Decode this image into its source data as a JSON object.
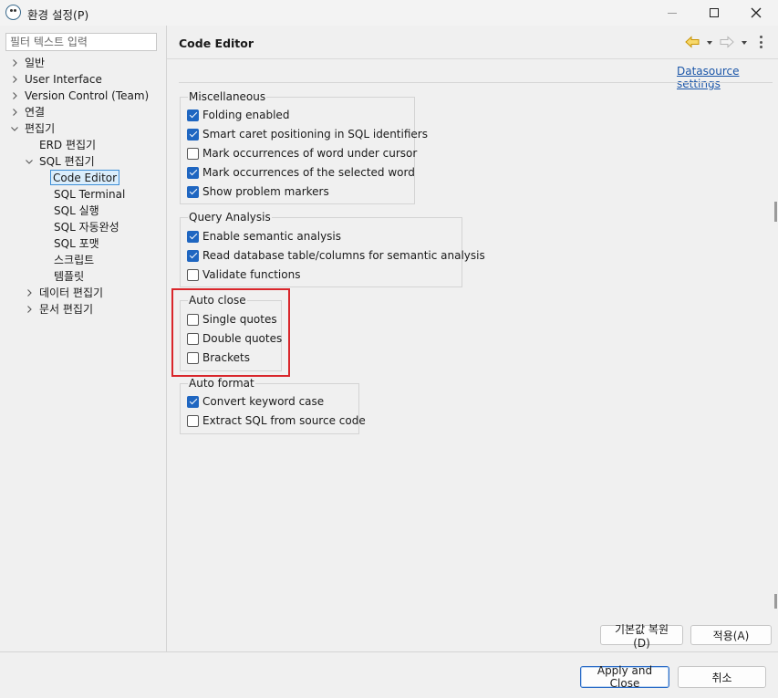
{
  "window": {
    "title": "환경 설정(P)"
  },
  "filter": {
    "placeholder": "필터 텍스트 입력"
  },
  "tree": {
    "items": [
      {
        "label": "일반"
      },
      {
        "label": "User Interface"
      },
      {
        "label": "Version Control (Team)"
      },
      {
        "label": "연결"
      },
      {
        "label": "편집기"
      },
      {
        "label": "ERD 편집기"
      },
      {
        "label": "SQL 편집기"
      },
      {
        "label": "Code Editor"
      },
      {
        "label": "SQL Terminal"
      },
      {
        "label": "SQL 실행"
      },
      {
        "label": "SQL 자동완성"
      },
      {
        "label": "SQL 포맷"
      },
      {
        "label": "스크립트"
      },
      {
        "label": "템플릿"
      },
      {
        "label": "데이터 편집기"
      },
      {
        "label": "문서 편집기"
      }
    ],
    "selected": "Code Editor"
  },
  "page": {
    "title": "Code Editor",
    "datasource_link": "Datasource settings"
  },
  "groups": {
    "miscellaneous": {
      "title": "Miscellaneous",
      "options": [
        {
          "label": "Folding enabled",
          "checked": true
        },
        {
          "label": "Smart caret positioning in SQL identifiers",
          "checked": true
        },
        {
          "label": "Mark occurrences of word under cursor",
          "checked": false
        },
        {
          "label": "Mark occurrences of the selected word",
          "checked": true
        },
        {
          "label": "Show problem markers",
          "checked": true
        }
      ]
    },
    "query_analysis": {
      "title": "Query Analysis",
      "options": [
        {
          "label": "Enable semantic analysis",
          "checked": true
        },
        {
          "label": "Read database table/columns for semantic analysis",
          "checked": true
        },
        {
          "label": "Validate functions",
          "checked": false
        }
      ]
    },
    "auto_close": {
      "title": "Auto close",
      "options": [
        {
          "label": "Single quotes",
          "checked": false
        },
        {
          "label": "Double quotes",
          "checked": false
        },
        {
          "label": "Brackets",
          "checked": false
        }
      ]
    },
    "auto_format": {
      "title": "Auto format",
      "options": [
        {
          "label": "Convert keyword case",
          "checked": true
        },
        {
          "label": "Extract SQL from source code",
          "checked": false
        }
      ]
    }
  },
  "buttons": {
    "restore_defaults": "기본값 복원(D)",
    "apply": "적용(A)",
    "apply_and_close": "Apply and Close",
    "cancel": "취소"
  },
  "colors": {
    "accent": "#1f66c1",
    "link": "#1a55a8",
    "highlight_box": "#d9262b",
    "nav_back_arrow": "#e6a817"
  },
  "icons": {
    "app": "dbeaver-beaver-icon",
    "back": "back-arrow-icon",
    "forward": "forward-arrow-icon",
    "menu": "vertical-ellipsis-icon"
  }
}
